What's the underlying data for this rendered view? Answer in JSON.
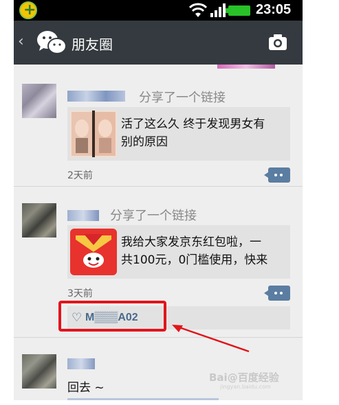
{
  "status_bar": {
    "time": "23:05"
  },
  "action_bar": {
    "back_icon": "chevron-left-icon",
    "app_icon": "wechat-icon",
    "title": "朋友圈",
    "camera_icon": "camera-icon"
  },
  "posts": [
    {
      "share_text": "分享了一个链接",
      "link_line1": "活了这么久 终于发现男女有",
      "link_line2": "别的原因",
      "time": "2天前"
    },
    {
      "share_text": "分享了一个链接",
      "link_line1": "我给大家发京东红包啦，一",
      "link_line2": "共100元，0门槛使用，快来",
      "time": "3天前",
      "liker": "M▒▒▒A02"
    },
    {
      "reply": "回去 ~"
    }
  ],
  "watermark": "Bai@百度经验 jingyan.baidu.com",
  "colors": {
    "status_bar": "#000000",
    "action_bar": "#343a3f",
    "feed_bg": "#eeeeee",
    "card_bg": "#e2e2e2",
    "accent_blue": "#4a6a8c",
    "highlight_red": "#e2141b"
  }
}
